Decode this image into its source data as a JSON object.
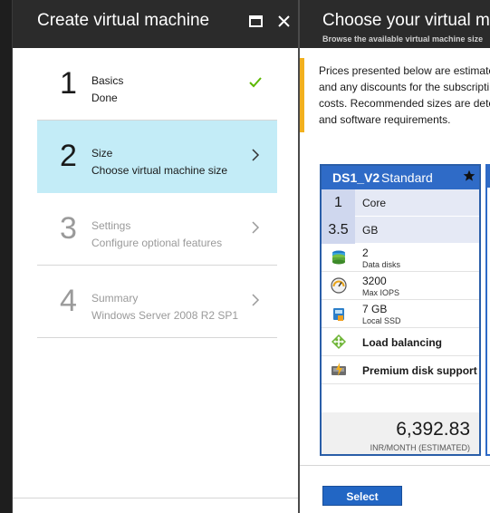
{
  "blade_left": {
    "title": "Create virtual machine",
    "icons": {
      "maximize": "maximize-icon",
      "close": "close-icon"
    },
    "steps": [
      {
        "number": "1",
        "title": "Basics",
        "subtitle": "Done",
        "state": "checkmark-icon"
      },
      {
        "number": "2",
        "title": "Size",
        "subtitle": "Choose virtual machine size",
        "state": "chevron-right-icon"
      },
      {
        "number": "3",
        "title": "Settings",
        "subtitle": "Configure optional features",
        "state": "chevron-right-icon"
      },
      {
        "number": "4",
        "title": "Summary",
        "subtitle": "Windows Server 2008 R2 SP1",
        "state": "chevron-right-icon"
      }
    ]
  },
  "blade_right": {
    "title": "Choose your virtual mac",
    "subtitle": "Browse the available virtual machine size",
    "notice_lines": [
      "Prices presented below are estimate",
      "and any discounts for the subscripti",
      "costs. Recommended sizes are deter",
      "and software requirements."
    ],
    "card": {
      "name": "DS1_V2",
      "tier": "Standard",
      "cores": {
        "value": "1",
        "unit": "Core"
      },
      "memory": {
        "value": "3.5",
        "unit": "GB"
      },
      "specs": [
        {
          "icon": "data-disks-icon",
          "value": "2",
          "label": "Data disks"
        },
        {
          "icon": "gauge-icon",
          "value": "3200",
          "label": "Max IOPS"
        },
        {
          "icon": "ssd-icon",
          "value": "7 GB",
          "label": "Local SSD"
        }
      ],
      "features": [
        {
          "icon": "load-balancing-icon",
          "label": "Load balancing"
        },
        {
          "icon": "premium-disk-icon",
          "label": "Premium disk support"
        }
      ],
      "price": "6,392.83",
      "price_unit": "INR/MONTH (ESTIMATED)"
    },
    "select_label": "Select"
  },
  "colors": {
    "header_bg": "#2b2b2b",
    "active_step": "#c3ecf7",
    "card_header": "#2f6bc7",
    "notice_accent": "#f2b01e",
    "check": "#5cb800"
  }
}
